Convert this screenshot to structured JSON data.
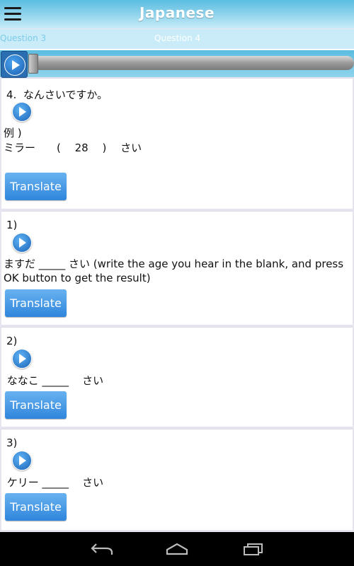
{
  "header": {
    "title": "Japanese",
    "menu_icon": "hamburger-menu-icon"
  },
  "tabs": {
    "previous": "Question 3",
    "current": "Question 4"
  },
  "player": {
    "progress": 0.0,
    "play_icon": "play-icon"
  },
  "question": {
    "prompt": "4.  なんさいですか。",
    "example_label": "例 )",
    "example_line": "ミラー　　(　 28　 )　 さい",
    "translate_label": "Translate"
  },
  "items": [
    {
      "number": "1)",
      "text": " ますだ _____    さい   (write the age you hear in the blank, and press OK button to get the result)",
      "translate_label": "Translate"
    },
    {
      "number": "2)",
      "text": " ななこ _____    さい",
      "translate_label": "Translate"
    },
    {
      "number": "3)",
      "text": " ケリー _____    さい",
      "translate_label": "Translate"
    }
  ],
  "navbar": {
    "icons": [
      "back-icon",
      "home-icon",
      "recent-apps-icon"
    ]
  },
  "colors": {
    "accent": "#5bbde0",
    "button": "#3d8fe0",
    "nav": "#000000"
  }
}
